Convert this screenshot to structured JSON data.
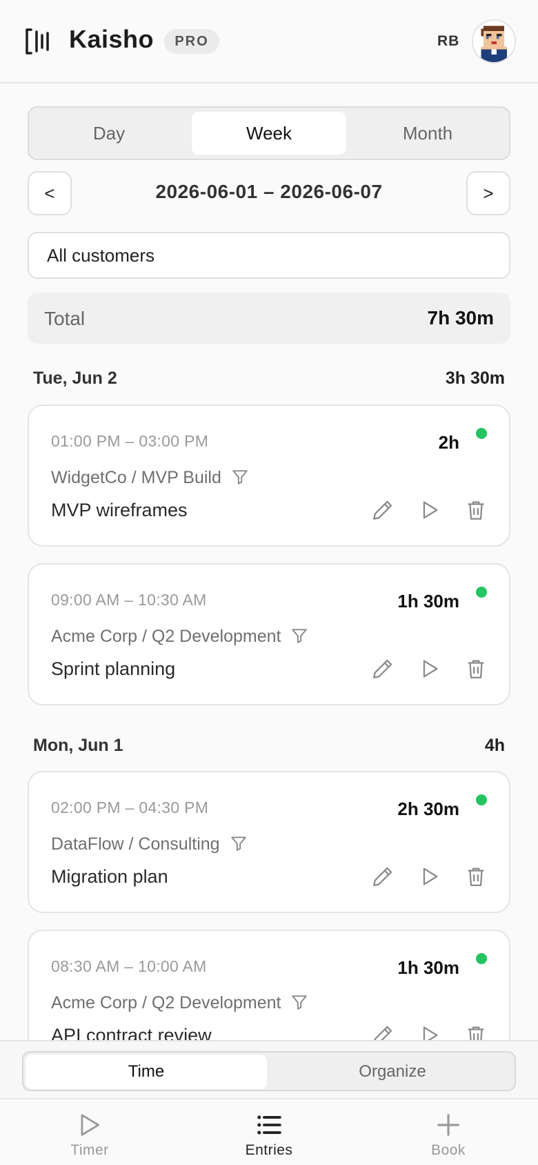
{
  "app": {
    "title": "Kaisho",
    "badge": "PRO",
    "user_initials": "RB"
  },
  "range_tabs": [
    {
      "label": "Day",
      "active": false
    },
    {
      "label": "Week",
      "active": true
    },
    {
      "label": "Month",
      "active": false
    }
  ],
  "date_nav": {
    "prev_label": "<",
    "next_label": ">",
    "range": "2026-06-01 – 2026-06-07"
  },
  "customer_filter": {
    "value": "All customers"
  },
  "total": {
    "label": "Total",
    "value": "7h 30m"
  },
  "days": [
    {
      "label": "Tue, Jun 2",
      "total": "3h 30m",
      "entries": [
        {
          "time": "01:00 PM – 03:00 PM",
          "duration": "2h",
          "project": "WidgetCo / MVP Build",
          "description": "MVP wireframes"
        },
        {
          "time": "09:00 AM – 10:30 AM",
          "duration": "1h 30m",
          "project": "Acme Corp / Q2 Development",
          "description": "Sprint planning"
        }
      ]
    },
    {
      "label": "Mon, Jun 1",
      "total": "4h",
      "entries": [
        {
          "time": "02:00 PM – 04:30 PM",
          "duration": "2h 30m",
          "project": "DataFlow / Consulting",
          "description": "Migration plan"
        },
        {
          "time": "08:30 AM – 10:00 AM",
          "duration": "1h 30m",
          "project": "Acme Corp / Q2 Development",
          "description": "API contract review"
        }
      ]
    }
  ],
  "view_toggle": [
    {
      "label": "Time",
      "active": true
    },
    {
      "label": "Organize",
      "active": false
    }
  ],
  "tabbar": [
    {
      "label": "Timer",
      "icon": "play-icon",
      "active": false
    },
    {
      "label": "Entries",
      "icon": "list-icon",
      "active": true
    },
    {
      "label": "Book",
      "icon": "plus-icon",
      "active": false
    }
  ],
  "colors": {
    "status_running": "#22c55e",
    "background": "#fafafa",
    "icon_gray": "#8a8a8a"
  }
}
